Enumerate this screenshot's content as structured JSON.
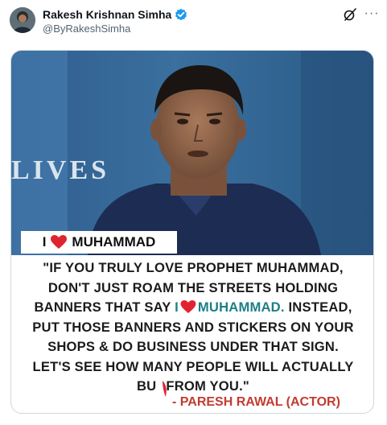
{
  "tweet": {
    "display_name": "Rakesh Krishnan Simha",
    "handle": "@ByRakeshSimha",
    "more_label": "···"
  },
  "image": {
    "backdrop_text": "LIVES",
    "banner": {
      "prefix": "I",
      "suffix": "MUHAMMAD"
    },
    "quote": {
      "line1": "\"IF YOU TRULY LOVE PROPHET MUHAMMAD,",
      "line2": "DON'T JUST ROAM THE STREETS HOLDING",
      "line3_a": "BANNERS THAT SAY",
      "line3_i": "I",
      "line3_m": "MUHAMMAD.",
      "line3_b": "INSTEAD,",
      "line4": "PUT THOSE BANNERS AND STICKERS ON YOUR",
      "line5": "SHOPS & DO BUSINESS UNDER THAT SIGN.",
      "line6": "LET'S SEE HOW MANY PEOPLE WILL ACTUALLY",
      "line7_a": "BU",
      "line7_b": "FROM YOU.\""
    },
    "attribution": "- PARESH RAWAL (ACTOR)"
  },
  "colors": {
    "verified": "#1d9bf0",
    "teal_text": "#1c7e86",
    "heart": "#e0242f",
    "attribution": "#c23b30"
  },
  "icons": [
    "verified-badge-icon",
    "grok-icon",
    "more-icon",
    "heart-icon"
  ]
}
